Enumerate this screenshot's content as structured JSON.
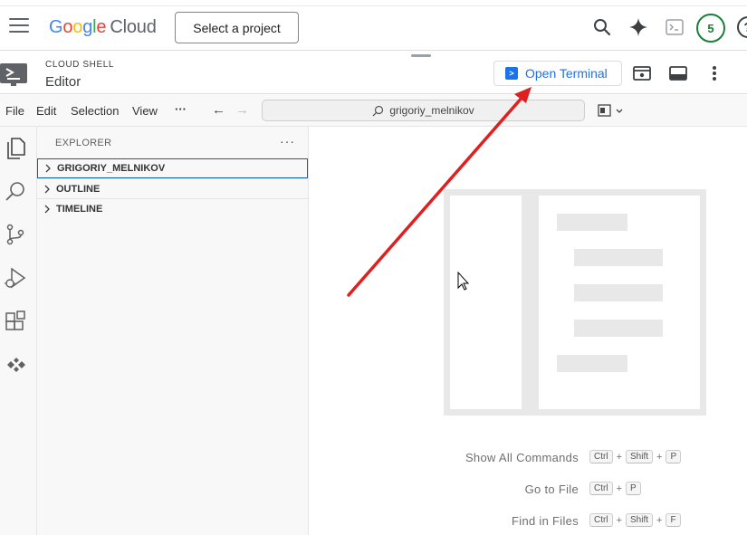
{
  "header": {
    "logo_google": [
      "G",
      "o",
      "o",
      "g",
      "l",
      "e"
    ],
    "logo_cloud": "Cloud",
    "project_button": "Select a project",
    "avatar_letter": "5",
    "help_label": "?"
  },
  "shell_bar": {
    "subtitle": "CLOUD SHELL",
    "title": "Editor",
    "open_terminal": "Open Terminal"
  },
  "menu": {
    "items": [
      "File",
      "Edit",
      "Selection",
      "View"
    ],
    "more": "···",
    "search_text": "grigoriy_melnikov"
  },
  "activity_bar": {
    "icons": [
      "explorer-icon",
      "search-icon",
      "source-control-icon",
      "run-debug-icon",
      "extensions-icon",
      "cloud-code-icon"
    ]
  },
  "sidebar": {
    "title": "EXPLORER",
    "more": "···",
    "sections": [
      "GRIGORIY_MELNIKOV",
      "OUTLINE",
      "TIMELINE"
    ]
  },
  "editor": {
    "shortcuts": [
      {
        "label": "Show All Commands",
        "keys": [
          "Ctrl",
          "Shift",
          "P"
        ]
      },
      {
        "label": "Go to File",
        "keys": [
          "Ctrl",
          "P"
        ]
      },
      {
        "label": "Find in Files",
        "keys": [
          "Ctrl",
          "Shift",
          "F"
        ]
      }
    ]
  },
  "colors": {
    "accent": "#1a73e8",
    "annotation_arrow": "#e02020",
    "avatar_border": "#188038",
    "focus_border": "#0e5fa8"
  }
}
